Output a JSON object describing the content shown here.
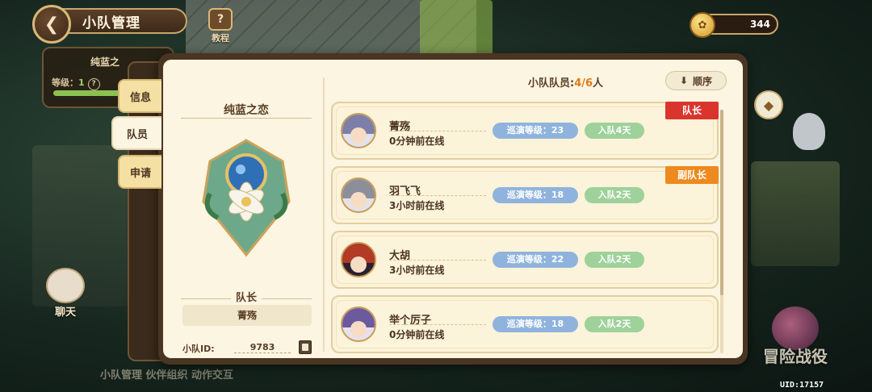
{
  "topbar": {
    "title": "小队管理",
    "tutorial_label": "教程",
    "currency_value": "344"
  },
  "behind_card": {
    "name": "纯蓝之",
    "level_label": "等级：",
    "level_value": "1",
    "progress": 0.6
  },
  "tabs": [
    {
      "label": "信息",
      "active": false
    },
    {
      "label": "队员",
      "active": true
    },
    {
      "label": "申请",
      "active": false
    }
  ],
  "team": {
    "name": "纯蓝之恋",
    "leader_title": "队长",
    "leader_name": "菁殇",
    "id_label": "小队ID:",
    "id_value": "9783"
  },
  "members_header": {
    "label": "小队队员:",
    "current": "4",
    "sep": "/",
    "max": "6",
    "unit": "人",
    "sort_label": "顺序"
  },
  "members": [
    {
      "name": "菁殇",
      "status": "0分钟前在线",
      "level": "巡演等级：23",
      "joined": "入队4天",
      "role": "队长",
      "avatar_color": "#7d7fa8"
    },
    {
      "name": "羽飞飞",
      "status": "3小时前在线",
      "level": "巡演等级：18",
      "joined": "入队2天",
      "role": "副队长",
      "avatar_color": "#8c8f9a"
    },
    {
      "name": "大胡",
      "status": "3小时前在线",
      "level": "巡演等级：22",
      "joined": "入队2天",
      "role": "",
      "avatar_color": "#b23a26"
    },
    {
      "name": "举个厉子",
      "status": "0分钟前在线",
      "level": "巡演等级：18",
      "joined": "入队2天",
      "role": "",
      "avatar_color": "#6b5a9e"
    }
  ],
  "background": {
    "chat_label": "聊天",
    "bottom_text": "小队管理  伙伴组织  动作交互",
    "adventure_label": "冒险战役",
    "uid": "UID:17157"
  },
  "colors": {
    "panel_bg": "#fbf5e1",
    "leader_badge": "#d9352c",
    "vice_badge": "#ec8a1e",
    "level_pill": "#8fb3dd",
    "days_pill": "#9fd19a",
    "count_highlight": "#e07a1a"
  }
}
